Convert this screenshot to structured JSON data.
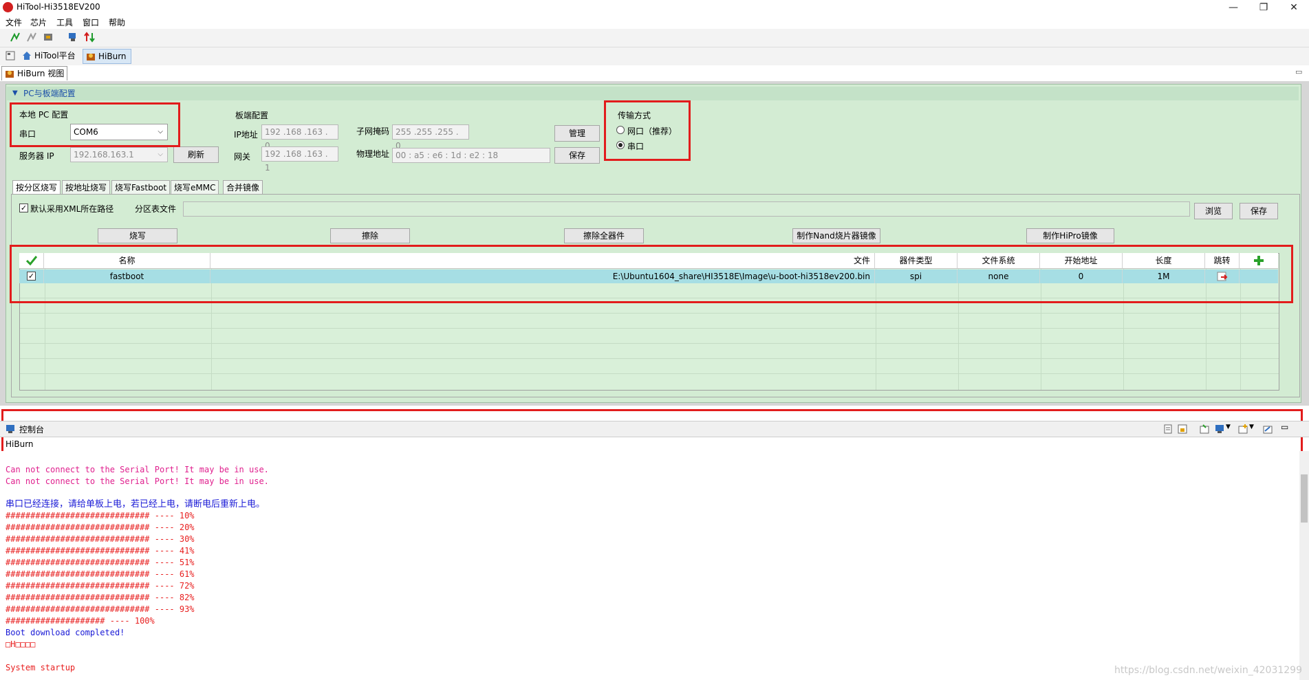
{
  "window": {
    "title": "HiTool-Hi3518EV200",
    "min_glyph": "—",
    "max_glyph": "❐",
    "close_glyph": "✕"
  },
  "menu": [
    "文件",
    "芯片",
    "工具",
    "窗口",
    "帮助"
  ],
  "toolbar_icons": [
    "connect-icon",
    "disconnect-icon",
    "chip-config-icon",
    "serial-tool-icon",
    "transfer-icon"
  ],
  "perspectives": {
    "platform": "HiTool平台",
    "hiburn": "HiBurn"
  },
  "view_tab": "HiBurn 视图",
  "section_title": "PC与板端配置",
  "local_pc": {
    "heading": "本地 PC 配置",
    "serial_label": "串口",
    "serial_value": "COM6",
    "server_ip_label": "服务器 IP",
    "server_ip_value": "192.168.163.1",
    "refresh_button": "刷新"
  },
  "board": {
    "heading": "板端配置",
    "ip_label": "IP地址",
    "ip_value": "192 .168 .163 .  0",
    "gateway_label": "网关",
    "gateway_value": "192 .168 .163 .  1",
    "netmask_label": "子网掩码",
    "netmask_value": "255 .255 .255 .  0",
    "mac_label": "物理地址",
    "mac_value": "00  :  a5  :  e6  :  1d  :  e2  :  18",
    "manage_button": "管理",
    "save_button": "保存"
  },
  "transfer": {
    "heading": "传输方式",
    "option_net": "网口（推荐）",
    "option_serial": "串口",
    "selected": "serial"
  },
  "subtabs": [
    "按分区烧写",
    "按地址烧写",
    "烧写Fastboot",
    "烧写eMMC",
    "合并镜像"
  ],
  "partition": {
    "use_xml_path_label": "默认采用XML所在路径",
    "use_xml_path_checked": true,
    "table_file_label": "分区表文件",
    "table_file_value": "",
    "browse_button": "浏览",
    "save_button": "保存"
  },
  "actions": {
    "burn": "烧写",
    "erase": "擦除",
    "erase_all": "擦除全器件",
    "make_nand": "制作Nand烧片器镜像",
    "make_hipro": "制作HiPro镜像"
  },
  "table": {
    "headers": {
      "name": "名称",
      "file": "文件",
      "device_type": "器件类型",
      "filesystem": "文件系统",
      "start_addr": "开始地址",
      "length": "长度",
      "jump": "跳转"
    },
    "rows": [
      {
        "checked": true,
        "name": "fastboot",
        "file": "E:\\Ubuntu1604_share\\HI3518E\\Image\\u-boot-hi3518ev200.bin",
        "device_type": "spi",
        "filesystem": "none",
        "start_addr": "0",
        "length": "1M"
      }
    ]
  },
  "console": {
    "tab": "控制台",
    "source": "HiBurn",
    "lines": [
      {
        "text": "Can not connect to the Serial Port! It may be in use.",
        "color": "pink"
      },
      {
        "text": "Can not connect to the Serial Port! It may be in use.",
        "color": "pink"
      },
      {
        "text": "串口已经连接，请给单板上电，若已经上电，请断电后重新上电。",
        "color": "blue"
      },
      {
        "text": "############################# ---- 10%",
        "color": "red"
      },
      {
        "text": "############################# ---- 20%",
        "color": "red"
      },
      {
        "text": "############################# ---- 30%",
        "color": "red"
      },
      {
        "text": "############################# ---- 41%",
        "color": "red"
      },
      {
        "text": "############################# ---- 51%",
        "color": "red"
      },
      {
        "text": "############################# ---- 61%",
        "color": "red"
      },
      {
        "text": "############################# ---- 72%",
        "color": "red"
      },
      {
        "text": "############################# ---- 82%",
        "color": "red"
      },
      {
        "text": "############################# ---- 93%",
        "color": "red"
      },
      {
        "text": "#################### ---- 100%",
        "color": "red"
      },
      {
        "text": "Boot download completed!",
        "color": "blue"
      },
      {
        "text": "□H□□□□",
        "color": "red"
      },
      {
        "text": "System startup",
        "color": "red"
      }
    ]
  },
  "watermark": "https://blog.csdn.net/weixin_42031299",
  "colors": {
    "highlight_box": "#e21c1c",
    "panel_green": "#d3ecd3",
    "row_selected": "#a6dee4",
    "console_pink": "#e0208e",
    "console_blue": "#1a1ad6",
    "console_red": "#e82020"
  }
}
